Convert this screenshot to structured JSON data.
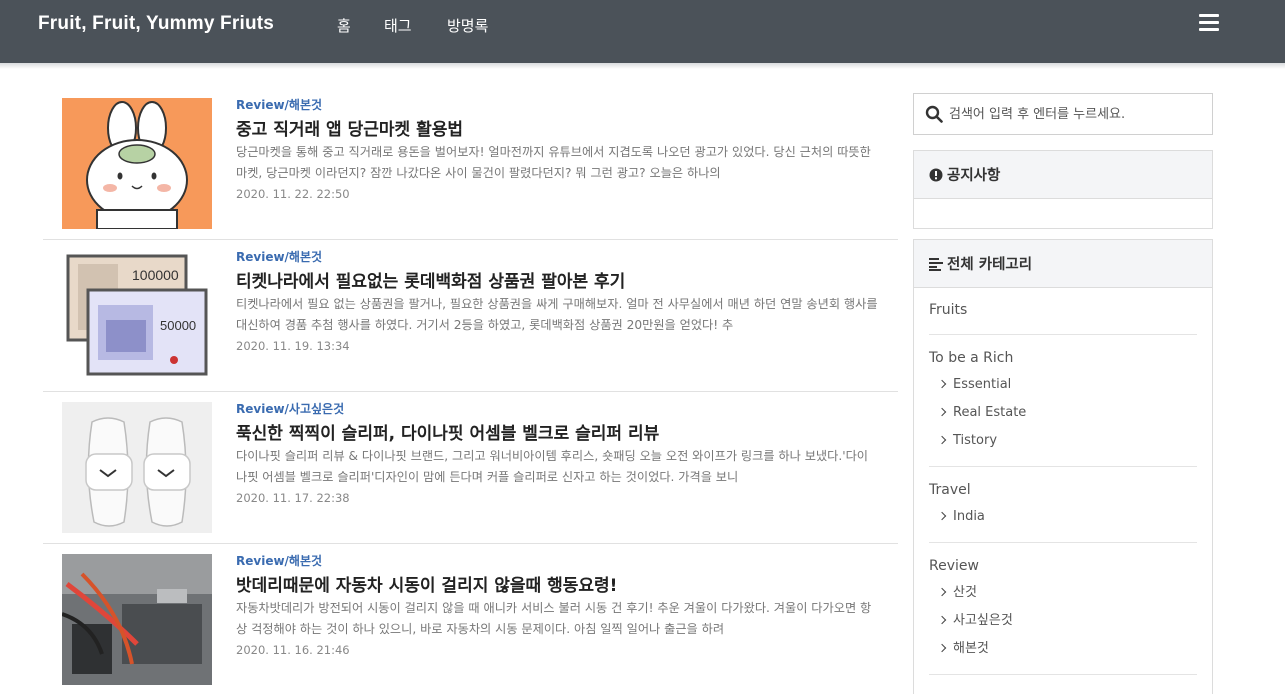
{
  "header": {
    "site_title": "Fruit, Fruit, Yummy Friuts",
    "nav": [
      "홈",
      "태그",
      "방명록"
    ]
  },
  "posts": [
    {
      "category": "Review/해본것",
      "title": "중고 직거래 앱 당근마켓 활용법",
      "excerpt": "당근마켓을 통해 중고 직거래로 용돈을 벌어보자! 얼마전까지 유튜브에서 지겹도록 나오던 광고가 있었다. 당신 근처의 따뜻한 마켓, 당근마켓 이라던지? 잠깐 나갔다온 사이 물건이 팔렸다던지? 뭐 그런 광고? 오늘은 하나의",
      "date": "2020. 11. 22. 22:50"
    },
    {
      "category": "Review/해본것",
      "title": "티켓나라에서 필요없는 롯데백화점 상품권 팔아본 후기",
      "excerpt": "티켓나라에서 필요 없는 상품권을 팔거나, 필요한 상품권을 싸게 구매해보자. 얼마 전 사무실에서 매년 하던 연말 송년회 행사를 대신하여 경품 추첨 행사를 하였다. 거기서 2등을 하였고, 롯데백화점 상품권 20만원을 얻었다! 추",
      "date": "2020. 11. 19. 13:34"
    },
    {
      "category": "Review/사고싶은것",
      "title": "푹신한 찍찍이 슬리퍼, 다이나핏 어셈블 벨크로 슬리퍼 리뷰",
      "excerpt": "다이나핏 슬리퍼 리뷰 & 다이나핏 브랜드, 그리고 워너비아이템 후리스, 숏패딩 오늘 오전 와이프가 링크를 하나 보냈다.'다이나핏 어셈블 벨크로 슬리퍼'디자인이 맘에 든다며 커플 슬리퍼로 신자고 하는 것이었다. 가격을 보니",
      "date": "2020. 11. 17. 22:38"
    },
    {
      "category": "Review/해본것",
      "title": "밧데리때문에 자동차 시동이 걸리지 않을때 행동요령!",
      "excerpt": "자동차밧데리가 방전되어 시동이 걸리지 않을 때 애니카 서비스 불러 시동 건 후기! 추운 겨울이 다가왔다. 겨울이 다가오면 항상 걱정해야 하는 것이 하나 있으니, 바로 자동차의 시동 문제이다. 아침 일찍 일어나 출근을 하려",
      "date": "2020. 11. 16. 21:46"
    }
  ],
  "sidebar": {
    "search_placeholder": "검색어 입력 후 엔터를 누르세요.",
    "notice_title": "공지사항",
    "category_title": "전체 카테고리",
    "categories": [
      {
        "name": "Fruits",
        "subs": []
      },
      {
        "name": "To be a Rich",
        "subs": [
          "Essential",
          "Real Estate",
          "Tistory"
        ]
      },
      {
        "name": "Travel",
        "subs": [
          "India"
        ]
      },
      {
        "name": "Review",
        "subs": [
          "산것",
          "사고싶은것",
          "해본것"
        ]
      }
    ]
  },
  "colors": {
    "topbar": "#4b5259",
    "category_link": "#3a6bb0"
  }
}
